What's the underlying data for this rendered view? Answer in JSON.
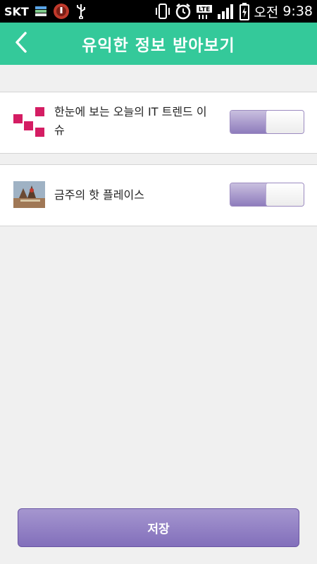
{
  "status_bar": {
    "carrier": "SKT",
    "lte_label": "LTE",
    "ampm": "오전",
    "time": "9:38",
    "icons": [
      "sim-icon",
      "music-icon",
      "usb-icon",
      "vibrate-icon",
      "alarm-icon",
      "lte-icon",
      "signal-icon",
      "battery-charging-icon"
    ]
  },
  "header": {
    "title": "유익한 정보 받아보기",
    "back_icon": "chevron-left-icon",
    "color": "#34c99a"
  },
  "items": [
    {
      "label": "한눈에 보는 오늘의 IT 트렌드 이슈",
      "thumbnail": "pink-squares-logo",
      "enabled": true
    },
    {
      "label": "금주의 핫 플레이스",
      "thumbnail": "place-photo",
      "enabled": true
    }
  ],
  "save_button": {
    "label": "저장",
    "color": "#8e7cbc"
  }
}
